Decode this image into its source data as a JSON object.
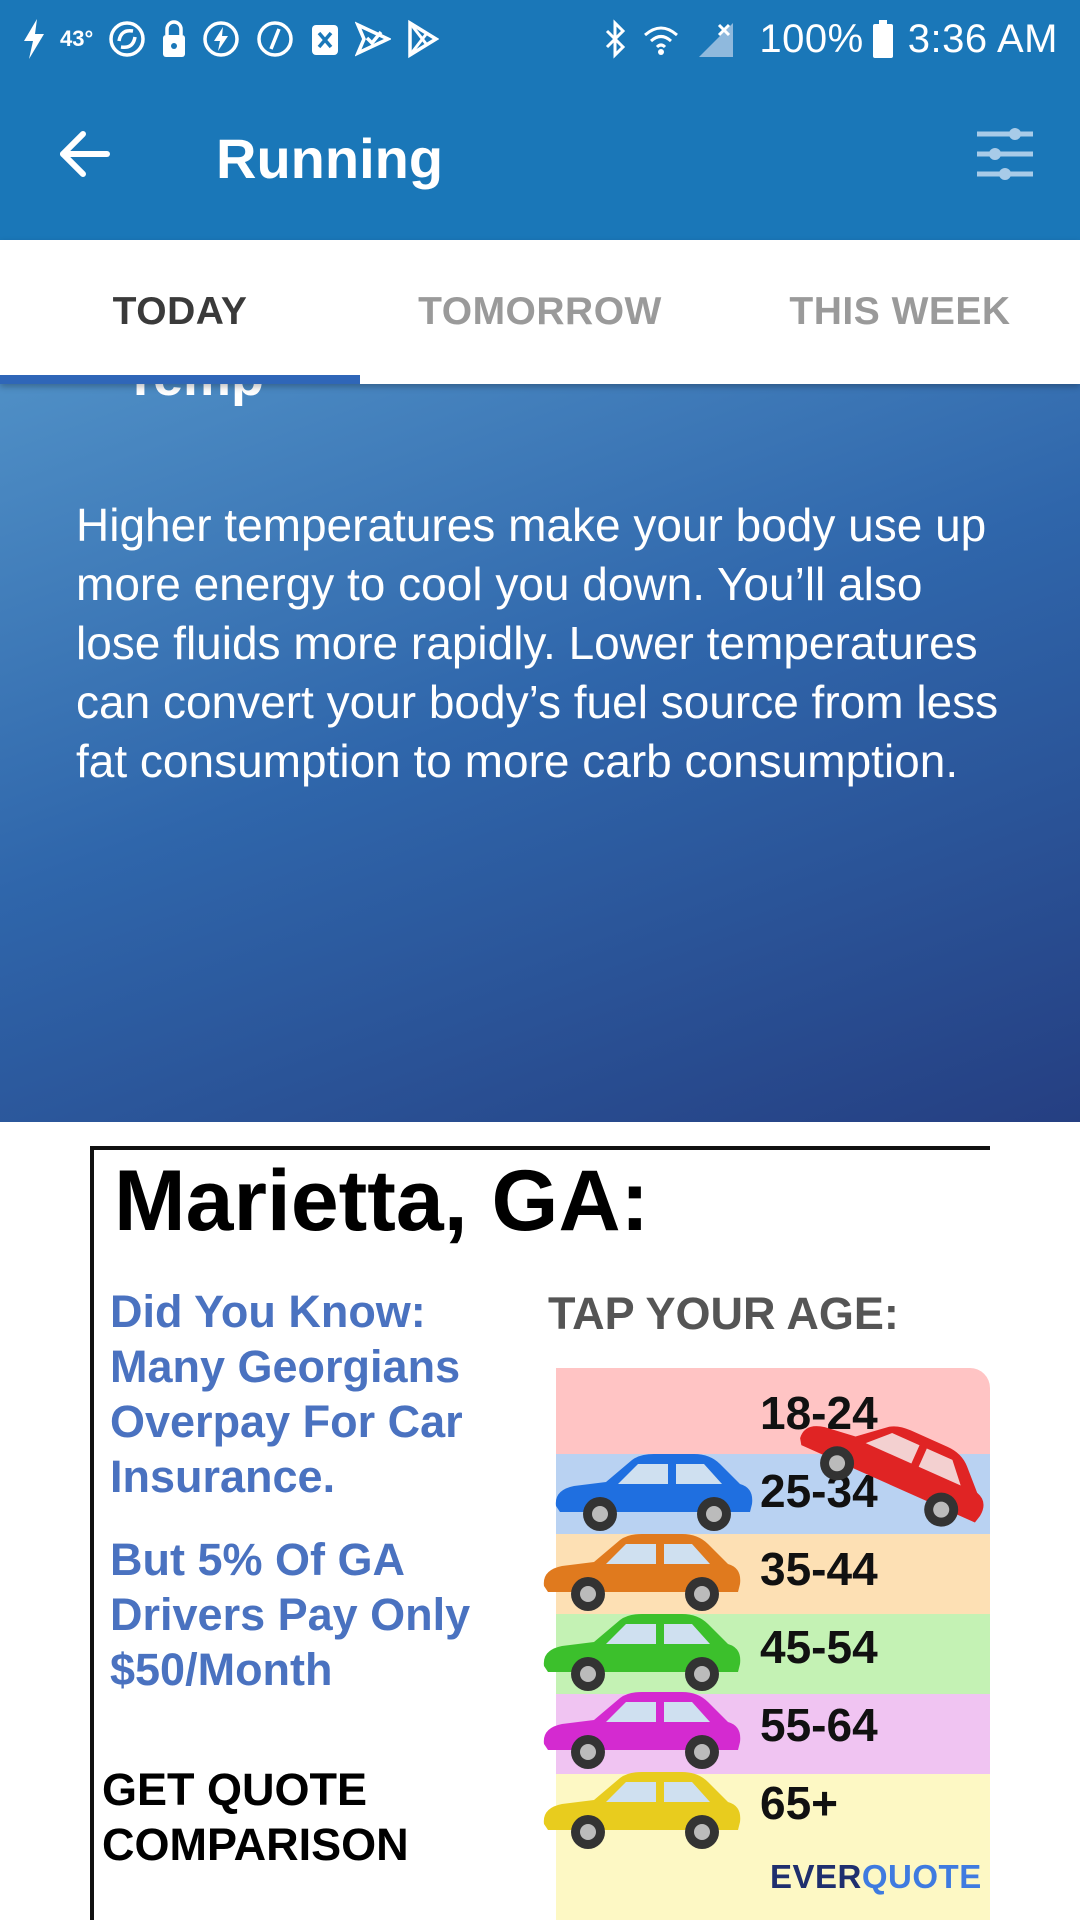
{
  "status_bar": {
    "temperature": "43°",
    "battery": "100%",
    "time": "3:36 AM",
    "left_icons": [
      "lightning-icon",
      "refresh-icon",
      "lock-icon",
      "bolt-circle-icon",
      "speed-icon",
      "close-box-icon",
      "check-send-icon",
      "play-store-icon"
    ],
    "right_icons": [
      "bluetooth-icon",
      "wifi-icon",
      "signal-icon",
      "battery-icon"
    ]
  },
  "app_bar": {
    "title": "Running",
    "back_icon": "arrow-left-icon",
    "filter_icon": "tune-icon",
    "color": "#1a77b8"
  },
  "tabs": [
    {
      "label": "TODAY",
      "active": true
    },
    {
      "label": "TOMORROW",
      "active": false
    },
    {
      "label": "THIS WEEK",
      "active": false
    }
  ],
  "info_panel": {
    "heading": "Temp",
    "body": "Higher temperatures make your body use up more energy to cool you down. You’ll also lose fluids more rapidly. Lower temperatures can convert your body’s fuel source from less fat consumption to more carb consumption."
  },
  "ad": {
    "city": "Marietta, GA:",
    "copy_1": "Did You Know: Many Georgians Overpay For Car Insurance.",
    "copy_2": "But 5% Of GA Drivers Pay Only $50/Month",
    "cta": "GET QUOTE COMPARISON",
    "tap_prompt": "TAP YOUR AGE:",
    "age_groups": [
      {
        "label": "18-24",
        "band_color": "#ffc4c4",
        "car_color": "#e02424"
      },
      {
        "label": "25-34",
        "band_color": "#b9d2f2",
        "car_color": "#1f6fe0"
      },
      {
        "label": "35-44",
        "band_color": "#fde0b4",
        "car_color": "#e07a1e"
      },
      {
        "label": "45-54",
        "band_color": "#c4f2b4",
        "car_color": "#3cc02c"
      },
      {
        "label": "55-64",
        "band_color": "#f0c4f2",
        "car_color": "#d42ad0"
      },
      {
        "label": "65+",
        "band_color": "#fdf8c4",
        "car_color": "#e8cc1e"
      }
    ],
    "brand_part_1": "EVER",
    "brand_part_2": "QUOTE",
    "brand_color_1": "#1f2f6e",
    "brand_color_2": "#3f7be0"
  }
}
